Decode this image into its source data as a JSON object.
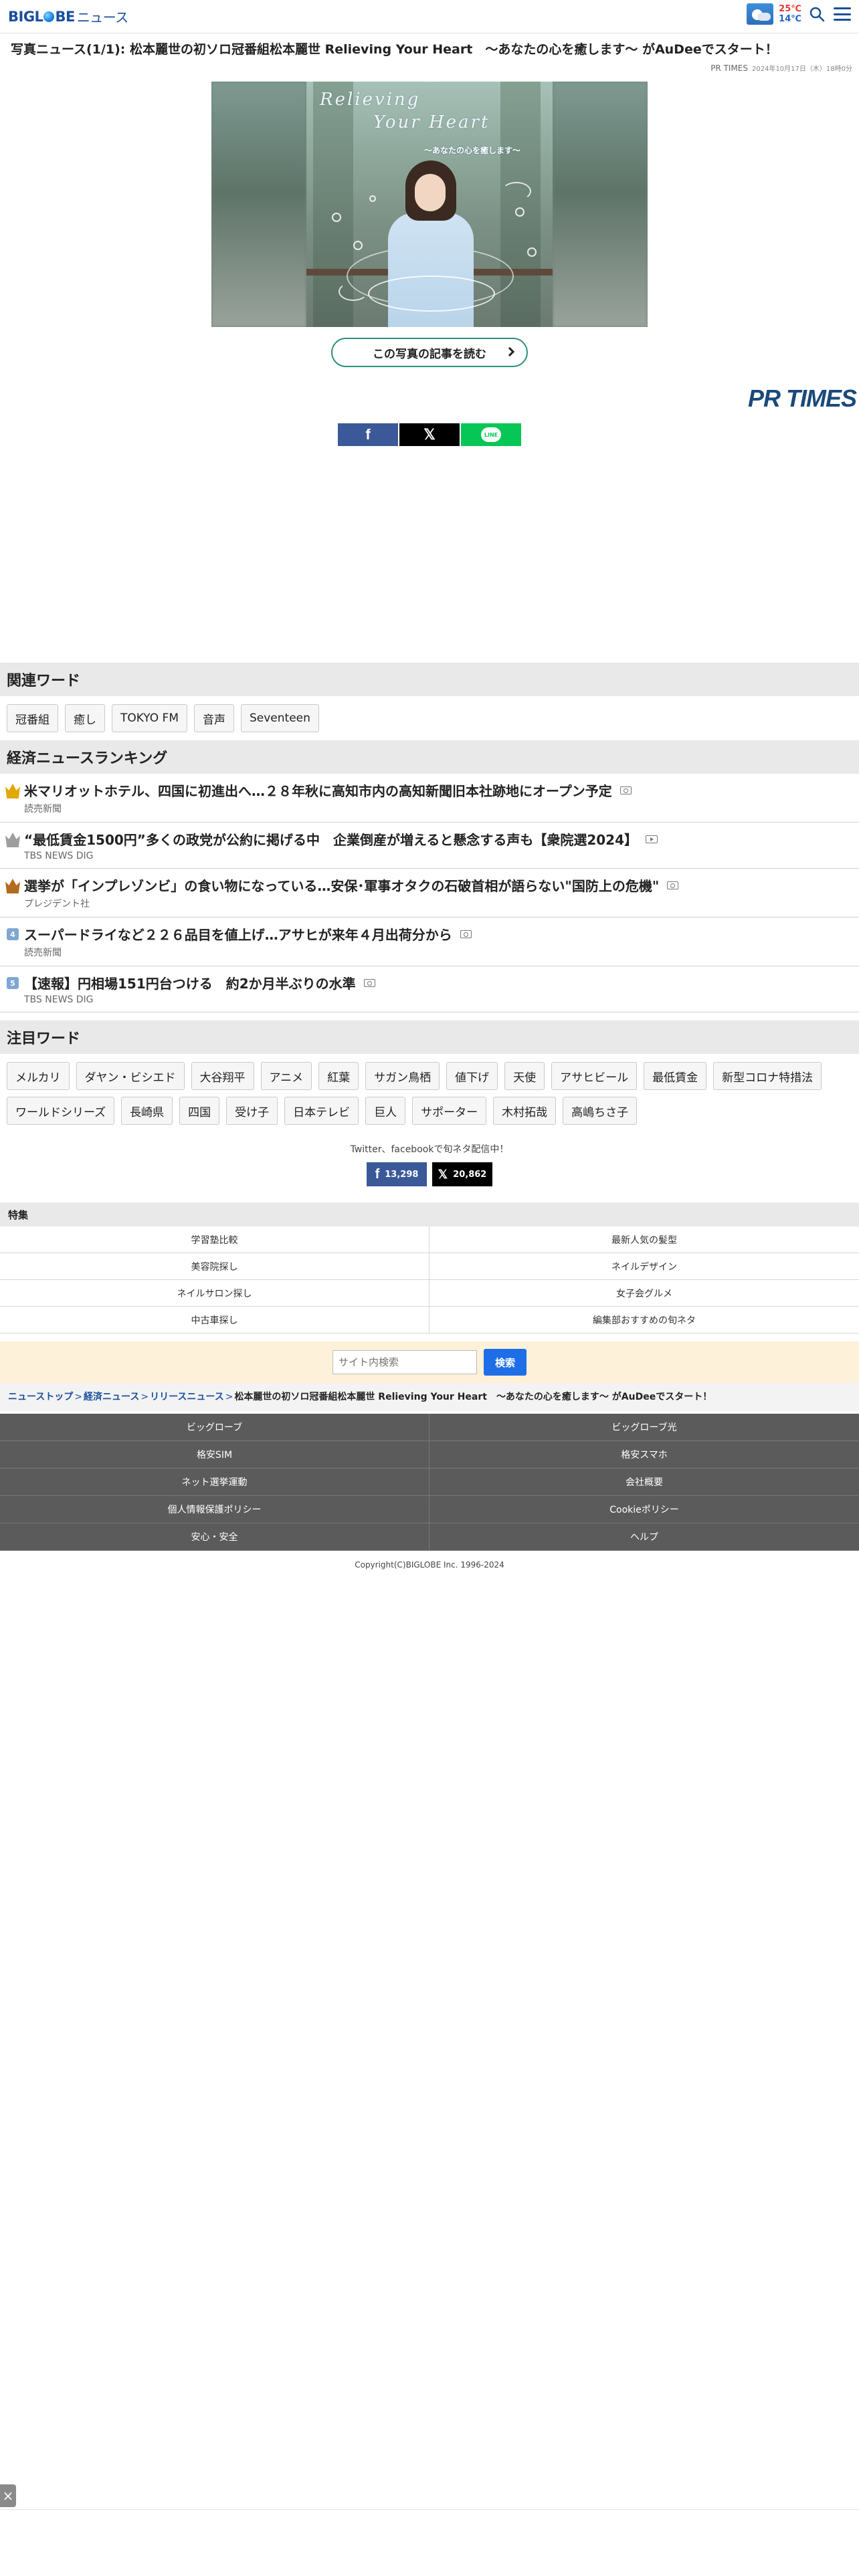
{
  "header": {
    "logo_big": "BIGL",
    "logo_be": "BE",
    "logo_news": "ニュース",
    "temp_high": "25℃",
    "temp_low": "14℃",
    "weather_icon": "partly-cloudy-icon",
    "search_icon": "search-icon",
    "menu_icon": "hamburger-menu-icon"
  },
  "article": {
    "title": "写真ニュース(1/1): 松本麗世の初ソロ冠番組松本麗世 Relieving Your Heart　〜あなたの心を癒します〜 がAuDeeでスタート！",
    "source": "PR TIMES",
    "date": "2024年10月17日（木）18時0分"
  },
  "photo": {
    "title_line1": "Relieving",
    "title_line2": "Your Heart",
    "subtitle": "〜あなたの心を癒します〜"
  },
  "read_button": "この写真の記事を読む",
  "prtimes_logo": "PR TIMES",
  "share": {
    "facebook_icon": "facebook-icon",
    "x_icon": "x-icon",
    "line_icon": "line-icon",
    "line_text": "LINE"
  },
  "related": {
    "heading": "関連ワード",
    "tags": [
      "冠番組",
      "癒し",
      "TOKYO FM",
      "音声",
      "Seventeen"
    ]
  },
  "ranking": {
    "heading": "経済ニュースランキング",
    "items": [
      {
        "rank": "1",
        "title": "米マリオットホテル、四国に初進出へ…２８年秋に高知市内の高知新聞旧本社跡地にオープン予定",
        "source": "読売新聞",
        "media": "camera"
      },
      {
        "rank": "2",
        "title": "“最低賃金1500円”多くの政党が公約に掲げる中　企業倒産が増えると懸念する声も【衆院選2024】",
        "source": "TBS NEWS DIG",
        "media": "video"
      },
      {
        "rank": "3",
        "title": "選挙が「インプレゾンビ」の食い物になっている…安保･軍事オタクの石破首相が語らない\"国防上の危機\"",
        "source": "プレジデント社",
        "media": "camera"
      },
      {
        "rank": "4",
        "title": "スーパードライなど２２６品目を値上げ…アサヒが来年４月出荷分から",
        "source": "読売新聞",
        "media": "camera"
      },
      {
        "rank": "5",
        "title": "【速報】円相場151円台つける　約2か月半ぶりの水準",
        "source": "TBS NEWS DIG",
        "media": "camera"
      }
    ]
  },
  "trending": {
    "heading": "注目ワード",
    "tags": [
      "メルカリ",
      "ダヤン・ビシエド",
      "大谷翔平",
      "アニメ",
      "紅葉",
      "サガン鳥栖",
      "値下げ",
      "天使",
      "アサヒビール",
      "最低賃金",
      "新型コロナ特措法",
      "ワールドシリーズ",
      "長崎県",
      "四国",
      "受け子",
      "日本テレビ",
      "巨人",
      "サポーター",
      "木村拓哉",
      "高嶋ちさ子"
    ]
  },
  "social": {
    "promo": "Twitter、facebookで旬ネタ配信中！",
    "fb_count": "13,298",
    "x_count": "20,862"
  },
  "special": {
    "heading": "特集",
    "items": [
      "学習塾比較",
      "最新人気の髪型",
      "美容院探し",
      "ネイルデザイン",
      "ネイルサロン探し",
      "女子会グルメ",
      "中古車探し",
      "編集部おすすめの旬ネタ"
    ]
  },
  "search": {
    "placeholder": "サイト内検索",
    "button": "検索"
  },
  "breadcrumb": {
    "home": "ニューストップ",
    "category": "経済ニュース",
    "sub": "リリースニュース",
    "sep": ">",
    "current": "松本麗世の初ソロ冠番組松本麗世 Relieving Your Heart　〜あなたの心を癒します〜 がAuDeeでスタート！"
  },
  "footer": {
    "links": [
      "ビッグローブ",
      "ビッグローブ光",
      "格安SIM",
      "格安スマホ",
      "ネット選挙運動",
      "会社概要",
      "個人情報保護ポリシー",
      "Cookieポリシー",
      "安心・安全",
      "ヘルプ"
    ],
    "copyright": "Copyright(C)BIGLOBE Inc. 1996-2024"
  },
  "float_close": "×"
}
